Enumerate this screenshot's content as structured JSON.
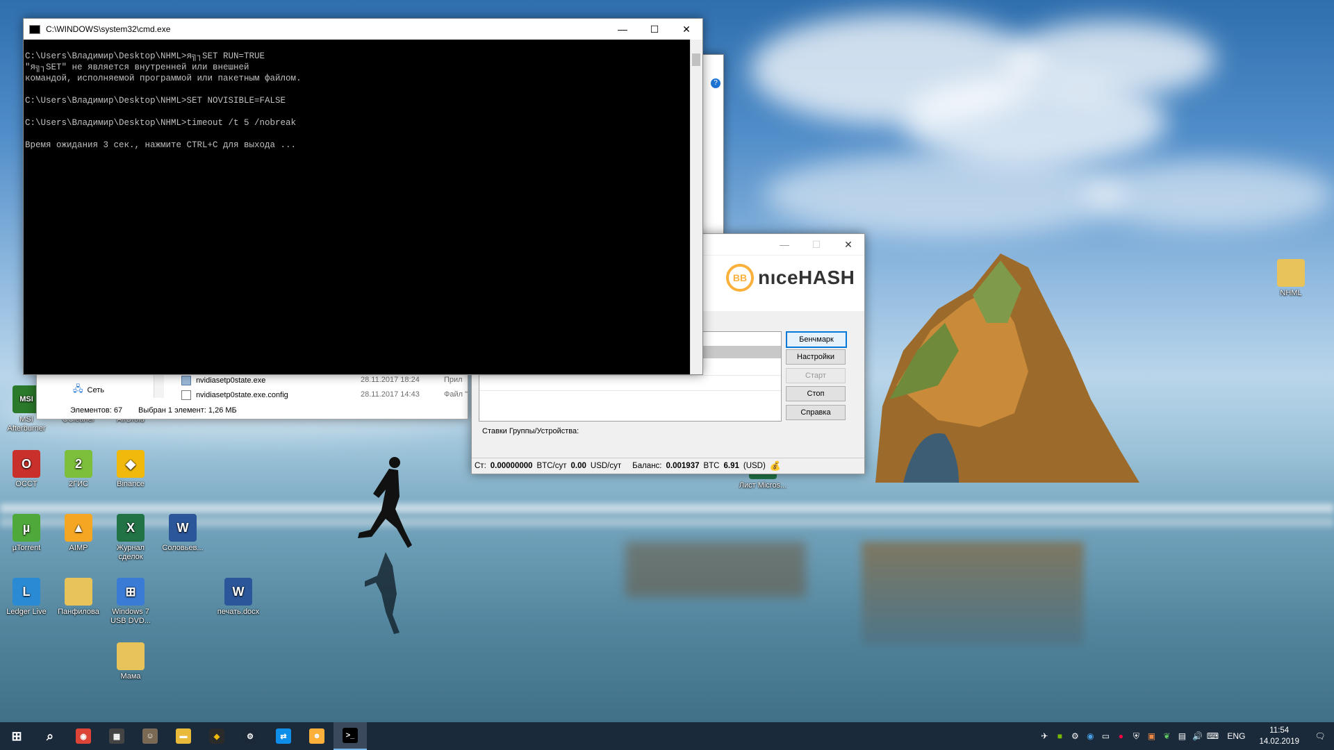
{
  "cmd": {
    "title": "C:\\WINDOWS\\system32\\cmd.exe",
    "lines": [
      "",
      "C:\\Users\\Владимир\\Desktop\\NHML>я╗┐SET RUN=TRUE",
      "\"я╗┐SET\" не является внутренней или внешней",
      "командой, исполняемой программой или пакетным файлом.",
      "",
      "C:\\Users\\Владимир\\Desktop\\NHML>SET NOVISIBLE=FALSE",
      "",
      "C:\\Users\\Владимир\\Desktop\\NHML>timeout /t 5 /nobreak",
      "",
      "Время ожидания 3 сек., нажмите CTRL+C для выхода ..."
    ]
  },
  "explorer": {
    "nav_item": "Сеть",
    "files": [
      {
        "name": "nvidiasetp0state.exe",
        "date": "28.11.2017 18:24",
        "type": "Прил"
      },
      {
        "name": "nvidiasetp0state.exe.config",
        "date": "28.11.2017 14:43",
        "type": "Файл \""
      }
    ],
    "status_count": "Элементов: 67",
    "status_selected": "Выбран 1 элемент: 1,26 МБ"
  },
  "nicehash": {
    "logo_text": "nıceHASH",
    "buttons": {
      "benchmark": "Бенчмарк",
      "settings": "Настройки",
      "start": "Старт",
      "stop": "Стоп",
      "help": "Справка"
    },
    "group_rates_label": "Ставки Группы/Устройства:",
    "status": {
      "rate_label": "Ст:",
      "rate_btc": "0.00000000",
      "rate_btc_unit": "BTC/сут",
      "rate_usd": "0.00",
      "rate_usd_unit": "USD/сут",
      "balance_label": "Баланс:",
      "balance_btc": "0.001937",
      "balance_btc_unit": "BTC",
      "balance_usd": "6.91",
      "balance_usd_unit": "(USD)"
    }
  },
  "desktop_icons": [
    {
      "label": "MSI Afterburner",
      "icon": "msi-afterburner-icon",
      "color": "#2b7a2b"
    },
    {
      "label": "CCleaner",
      "icon": "ccleaner-icon",
      "color": "#1f6fb5"
    },
    {
      "label": "AirDroid",
      "icon": "airdroid-icon",
      "color": "#2fa34a"
    },
    {
      "label": "OCCT",
      "icon": "occt-icon",
      "color": "#c9302c"
    },
    {
      "label": "2ГИС",
      "icon": "2gis-icon",
      "color": "#7cbf3a"
    },
    {
      "label": "Binance",
      "icon": "binance-icon",
      "color": "#f0b90b"
    },
    {
      "label": "µTorrent",
      "icon": "utorrent-icon",
      "color": "#4fa83a"
    },
    {
      "label": "AIMP",
      "icon": "aimp-icon",
      "color": "#f5a623"
    },
    {
      "label": "Журнал сделок",
      "icon": "excel-icon",
      "color": "#217346"
    },
    {
      "label": "Соловьев...",
      "icon": "word-icon",
      "color": "#2b579a"
    },
    {
      "label": "Ledger Live",
      "icon": "ledger-icon",
      "color": "#2a8ad4"
    },
    {
      "label": "Панфилова",
      "icon": "folder-icon",
      "color": "#e8c35a"
    },
    {
      "label": "Windows 7 USB DVD...",
      "icon": "windows-usb-icon",
      "color": "#3a7bd5"
    },
    {
      "label": "печать.docx",
      "icon": "word-icon",
      "color": "#2b579a"
    },
    {
      "label": "Мама",
      "icon": "folder-icon",
      "color": "#e8c35a"
    },
    {
      "label": "NHML",
      "icon": "folder-icon",
      "color": "#e8c35a"
    },
    {
      "label": "Лист Micros...",
      "icon": "excel-icon",
      "color": "#217346"
    }
  ],
  "taskbar": {
    "apps": [
      {
        "name": "start-button",
        "icon": "windows-icon"
      },
      {
        "name": "search-button",
        "icon": "search-icon"
      },
      {
        "name": "chrome",
        "icon": "chrome-icon"
      },
      {
        "name": "calculator",
        "icon": "calculator-icon"
      },
      {
        "name": "app-photo",
        "icon": "person-app-icon"
      },
      {
        "name": "file-explorer",
        "icon": "folder-icon"
      },
      {
        "name": "binance",
        "icon": "binance-icon"
      },
      {
        "name": "steam",
        "icon": "steam-icon"
      },
      {
        "name": "teamviewer",
        "icon": "teamviewer-icon"
      },
      {
        "name": "nicehash",
        "icon": "nicehash-icon"
      },
      {
        "name": "cmd",
        "icon": "cmd-icon"
      }
    ],
    "language": "ENG",
    "time": "11:54",
    "date": "14.02.2019"
  }
}
